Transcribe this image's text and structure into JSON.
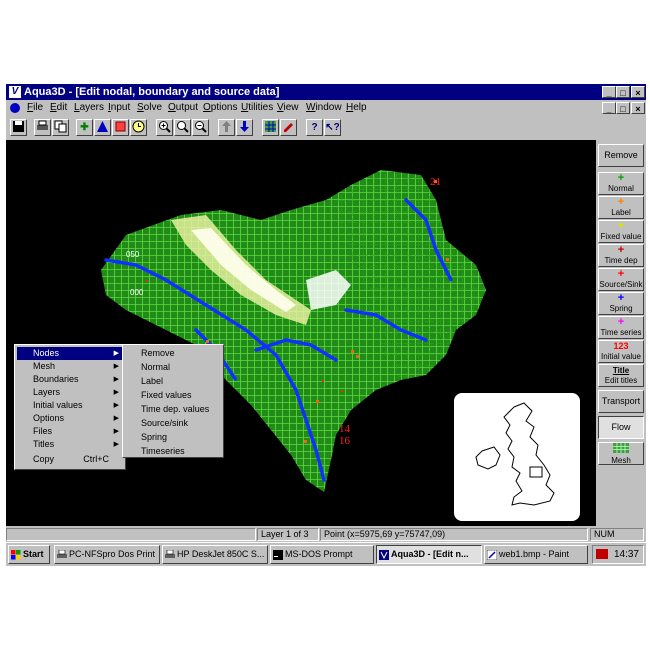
{
  "window": {
    "title": "Aqua3D - [Edit nodal, boundary and source data]",
    "icon": "aqua3d-logo-icon",
    "caption_buttons": [
      "_",
      "□",
      "×"
    ],
    "doc_caption_buttons": [
      "_",
      "□",
      "×"
    ]
  },
  "menubar": {
    "items": [
      "File",
      "Edit",
      "Layers",
      "Input",
      "Solve",
      "Output",
      "Options",
      "Utilities",
      "View",
      "Window",
      "Help"
    ]
  },
  "toolbar": {
    "buttons": [
      "save-icon",
      "print-icon",
      "copy-icon",
      "move-icon",
      "triangle-icon",
      "square-icon",
      "clock-icon",
      "zoom-in-icon",
      "zoom-window-icon",
      "zoom-out-icon",
      "arrow-up-icon",
      "arrow-down-icon",
      "mesh-icon",
      "pencil-icon",
      "help-icon",
      "context-help-icon"
    ]
  },
  "canvas": {
    "labels": {
      "node_21": "21",
      "node_14": "14",
      "node_16": "16"
    },
    "ticks": [
      "050",
      "000"
    ]
  },
  "right_panel": {
    "remove": "Remove",
    "normal": {
      "label": "Normal",
      "symbol": "+",
      "color": "#00a000"
    },
    "label": {
      "label": "Label",
      "symbol": "+",
      "color": "#ff8000"
    },
    "fixed_value": {
      "label": "Fixed value",
      "symbol": "+",
      "color": "#e0e000"
    },
    "time_dep": {
      "label": "Time dep",
      "symbol": "+",
      "color": "#c00000"
    },
    "source_sink": {
      "label": "Source/Sink",
      "symbol": "+",
      "color": "#ff0000"
    },
    "spring": {
      "label": "Spring",
      "symbol": "+",
      "color": "#0000ff"
    },
    "time_series": {
      "label": "Time series",
      "symbol": "+",
      "color": "#ff00ff"
    },
    "initial_value": {
      "label": "Initial value",
      "symbol": "123",
      "color": "#ff0000"
    },
    "edit_titles": {
      "label": "Edit titles",
      "symbol": "Title"
    },
    "transport": "Transport",
    "flow": "Flow",
    "mesh": "Mesh"
  },
  "context_menu": {
    "items": [
      {
        "label": "Nodes",
        "submenu": true,
        "selected": true
      },
      {
        "label": "Mesh",
        "submenu": true
      },
      {
        "label": "Boundaries",
        "submenu": true
      },
      {
        "label": "Layers",
        "submenu": true
      },
      {
        "label": "Initial values",
        "submenu": true
      },
      {
        "label": "Options",
        "submenu": true
      },
      {
        "label": "Files",
        "submenu": true
      },
      {
        "label": "Titles",
        "submenu": true
      },
      {
        "label": "Copy",
        "shortcut": "Ctrl+C"
      }
    ],
    "submenu": [
      "Remove",
      "Normal",
      "Label",
      "Fixed values",
      "Time dep. values",
      "Source/sink",
      "Spring",
      "Timeseries"
    ]
  },
  "statusbar": {
    "layer": "Layer 1 of 3",
    "point": "Point (x=5975,69 y=75747,09)",
    "num": "NUM"
  },
  "taskbar": {
    "start": "Start",
    "tasks": [
      "PC-NFSpro Dos Print",
      "HP DeskJet 850C S...",
      "MS-DOS Prompt",
      "Aqua3D - [Edit n...",
      "web1.bmp - Paint"
    ],
    "clock": "14:37"
  }
}
